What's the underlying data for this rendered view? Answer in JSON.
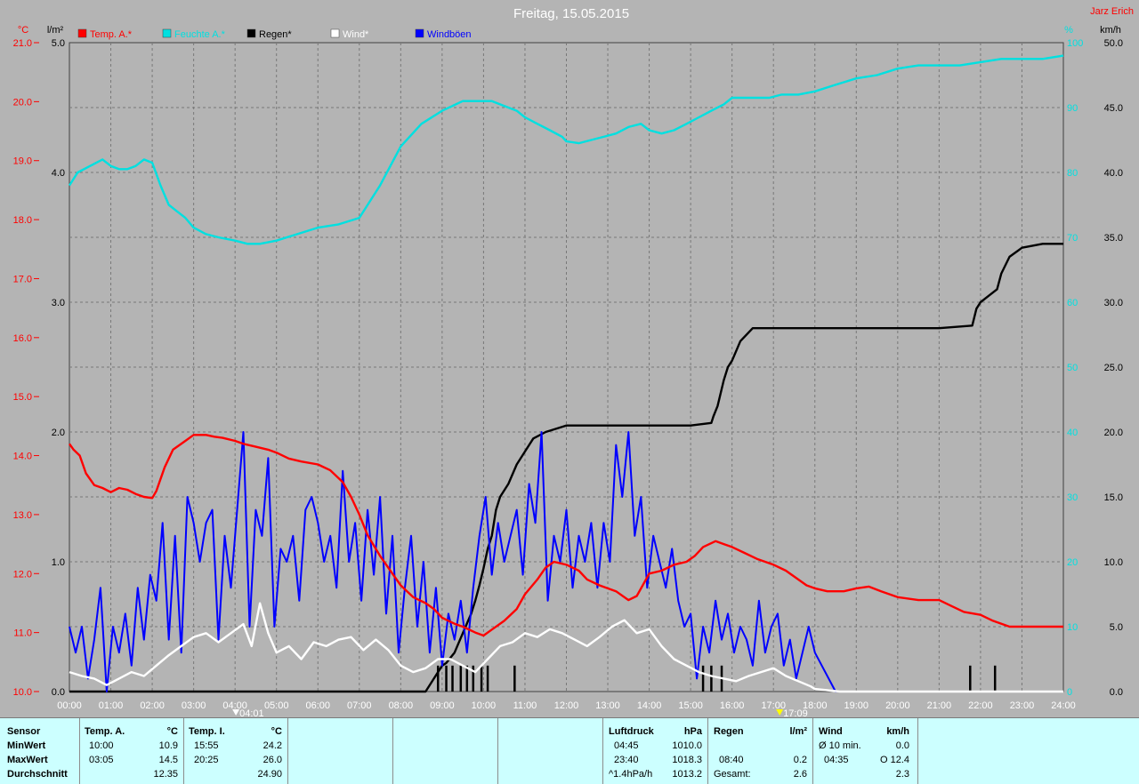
{
  "chart_data": {
    "type": "line",
    "title": "Freitag, 15.05.2015",
    "author": "Jarz Erich",
    "legend": [
      {
        "name": "Temp. A.*",
        "color": "#ff0000"
      },
      {
        "name": "Feuchte A.*",
        "color": "#00e0e0"
      },
      {
        "name": "Regen*",
        "color": "#000000"
      },
      {
        "name": "Wind*",
        "color": "#ffffff"
      },
      {
        "name": "Windböen",
        "color": "#0000ff"
      }
    ],
    "legend_placement": "top-left",
    "grid": true,
    "axes": {
      "temp": {
        "unit": "°C",
        "color": "#ff0000",
        "range": [
          10,
          21
        ],
        "ticks": [
          "10.0",
          "11.0",
          "12.0",
          "13.0",
          "14.0",
          "15.0",
          "16.0",
          "17.0",
          "18.0",
          "19.0",
          "20.0",
          "21.0"
        ]
      },
      "rain": {
        "unit": "l/m²",
        "color": "#000000",
        "range": [
          0,
          5
        ],
        "ticks": [
          "0.0",
          "1.0",
          "2.0",
          "3.0",
          "4.0",
          "5.0"
        ]
      },
      "humidity": {
        "unit": "%",
        "color": "#00e0e0",
        "range": [
          0,
          100
        ],
        "ticks": [
          "0",
          "10",
          "20",
          "30",
          "40",
          "50",
          "60",
          "70",
          "80",
          "90",
          "100"
        ]
      },
      "wind": {
        "unit": "km/h",
        "color": "#000000",
        "range": [
          0,
          50
        ],
        "ticks": [
          "0.0",
          "5.0",
          "10.0",
          "15.0",
          "20.0",
          "25.0",
          "30.0",
          "35.0",
          "40.0",
          "45.0",
          "50.0"
        ]
      }
    },
    "x_range": [
      0,
      24
    ],
    "x_ticks": [
      "00:00",
      "01:00",
      "02:00",
      "03:00",
      "04:00",
      "05:00",
      "06:00",
      "07:00",
      "08:00",
      "09:00",
      "10:00",
      "11:00",
      "12:00",
      "13:00",
      "14:00",
      "15:00",
      "16:00",
      "17:00",
      "18:00",
      "19:00",
      "20:00",
      "21:00",
      "22:00",
      "23:00",
      "24:00"
    ],
    "markers": [
      {
        "label": "04:01",
        "x": 4.02,
        "color": "#ffffff"
      },
      {
        "label": "17:09",
        "x": 17.15,
        "color": "#ffff00"
      }
    ],
    "series": [
      {
        "name": "Temp. A.*",
        "axis": "temp",
        "color": "#ff0000",
        "x": [
          0,
          0.1,
          0.25,
          0.4,
          0.6,
          0.8,
          1.0,
          1.2,
          1.4,
          1.6,
          1.8,
          2.0,
          2.1,
          2.3,
          2.5,
          2.8,
          3.0,
          3.1,
          3.3,
          3.5,
          3.7,
          4.0,
          4.2,
          4.5,
          4.8,
          5.0,
          5.3,
          5.6,
          6.0,
          6.3,
          6.6,
          6.8,
          7.0,
          7.2,
          7.5,
          7.8,
          8.0,
          8.3,
          8.6,
          8.8,
          9.0,
          9.3,
          9.5,
          9.8,
          10.0,
          10.2,
          10.5,
          10.8,
          11.0,
          11.3,
          11.5,
          11.7,
          12.0,
          12.3,
          12.5,
          12.8,
          13.0,
          13.2,
          13.5,
          13.7,
          14.0,
          14.3,
          14.6,
          14.9,
          15.1,
          15.3,
          15.6,
          15.8,
          16.0,
          16.3,
          16.6,
          16.8,
          17.0,
          17.3,
          17.6,
          17.8,
          18.0,
          18.3,
          18.7,
          19.0,
          19.3,
          19.6,
          20.0,
          20.5,
          21.0,
          21.3,
          21.6,
          22.0,
          22.3,
          22.7,
          23.0,
          23.5,
          24.0
        ],
        "y": [
          14.2,
          14.1,
          14.0,
          13.7,
          13.5,
          13.45,
          13.38,
          13.45,
          13.42,
          13.35,
          13.3,
          13.28,
          13.4,
          13.8,
          14.1,
          14.25,
          14.35,
          14.35,
          14.35,
          14.32,
          14.3,
          14.25,
          14.2,
          14.15,
          14.1,
          14.05,
          13.95,
          13.9,
          13.85,
          13.75,
          13.55,
          13.3,
          13.0,
          12.65,
          12.3,
          12.0,
          11.8,
          11.6,
          11.5,
          11.4,
          11.25,
          11.15,
          11.1,
          11.0,
          10.95,
          11.05,
          11.2,
          11.4,
          11.65,
          11.9,
          12.1,
          12.2,
          12.15,
          12.05,
          11.9,
          11.8,
          11.75,
          11.7,
          11.55,
          11.62,
          12.0,
          12.05,
          12.15,
          12.2,
          12.3,
          12.45,
          12.55,
          12.5,
          12.45,
          12.35,
          12.25,
          12.2,
          12.15,
          12.05,
          11.9,
          11.8,
          11.75,
          11.7,
          11.7,
          11.75,
          11.78,
          11.7,
          11.6,
          11.55,
          11.55,
          11.45,
          11.35,
          11.3,
          11.2,
          11.1,
          11.1,
          11.1,
          11.1
        ]
      },
      {
        "name": "Feuchte A.*",
        "axis": "humidity",
        "color": "#00e0e0",
        "x": [
          0,
          0.2,
          0.5,
          0.8,
          1.0,
          1.2,
          1.4,
          1.6,
          1.8,
          2.0,
          2.2,
          2.4,
          2.6,
          2.8,
          3.0,
          3.3,
          3.6,
          4.0,
          4.3,
          4.6,
          5.0,
          5.5,
          6.0,
          6.5,
          7.0,
          7.5,
          8.0,
          8.5,
          9.0,
          9.5,
          10.0,
          10.2,
          10.4,
          10.8,
          11.0,
          11.3,
          11.6,
          11.9,
          12.0,
          12.3,
          12.6,
          12.9,
          13.2,
          13.5,
          13.8,
          14.0,
          14.3,
          14.6,
          14.9,
          15.2,
          15.5,
          15.8,
          16.0,
          16.3,
          16.6,
          16.9,
          17.2,
          17.6,
          18.0,
          18.5,
          19.0,
          19.5,
          20.0,
          20.5,
          21.0,
          21.5,
          22.0,
          22.5,
          23.0,
          23.5,
          24.0
        ],
        "y": [
          78,
          80,
          81,
          82,
          81,
          80.5,
          80.5,
          81,
          82,
          81.5,
          78,
          75,
          74,
          73,
          71.5,
          70.5,
          70,
          69.5,
          69,
          69,
          69.5,
          70.5,
          71.5,
          72,
          73,
          78,
          84,
          87.5,
          89.5,
          91,
          91,
          91,
          90.5,
          89.5,
          88.5,
          87.5,
          86.5,
          85.5,
          84.8,
          84.5,
          85,
          85.5,
          86,
          87,
          87.5,
          86.5,
          86,
          86.5,
          87.5,
          88.5,
          89.5,
          90.5,
          91.5,
          91.5,
          91.5,
          91.5,
          92,
          92,
          92.5,
          93.5,
          94.5,
          95,
          96,
          96.5,
          96.5,
          96.5,
          97,
          97.5,
          97.5,
          97.5,
          98
        ]
      },
      {
        "name": "Regen*",
        "axis": "rain",
        "color": "#000000",
        "x": [
          0,
          8.6,
          8.8,
          9.0,
          9.1,
          9.3,
          9.5,
          9.7,
          9.8,
          9.9,
          10.0,
          10.1,
          10.2,
          10.3,
          10.4,
          10.6,
          10.8,
          11.0,
          11.2,
          11.5,
          12.0,
          13.0,
          14.0,
          15.0,
          15.5,
          15.55,
          15.65,
          15.8,
          15.9,
          16.0,
          16.2,
          16.5,
          17.0,
          18.0,
          19.0,
          20.0,
          21.0,
          21.8,
          21.9,
          22.0,
          22.2,
          22.4,
          22.5,
          22.7,
          23.0,
          23.5,
          24.0
        ],
        "y": [
          0,
          0,
          0.1,
          0.2,
          0.22,
          0.3,
          0.45,
          0.6,
          0.7,
          0.82,
          0.95,
          1.1,
          1.2,
          1.4,
          1.5,
          1.6,
          1.75,
          1.85,
          1.95,
          2.0,
          2.05,
          2.05,
          2.05,
          2.05,
          2.07,
          2.12,
          2.2,
          2.4,
          2.5,
          2.55,
          2.7,
          2.8,
          2.8,
          2.8,
          2.8,
          2.8,
          2.8,
          2.82,
          2.95,
          3.0,
          3.05,
          3.1,
          3.22,
          3.35,
          3.42,
          3.45,
          3.45
        ]
      },
      {
        "name": "Wind*",
        "axis": "wind",
        "color": "#ffffff",
        "x": [
          0,
          0.3,
          0.6,
          0.9,
          1.2,
          1.5,
          1.8,
          2.1,
          2.4,
          2.7,
          3.0,
          3.3,
          3.6,
          3.9,
          4.2,
          4.4,
          4.6,
          4.8,
          5.0,
          5.3,
          5.6,
          5.9,
          6.2,
          6.5,
          6.8,
          7.1,
          7.4,
          7.7,
          8.0,
          8.3,
          8.6,
          8.9,
          9.2,
          9.5,
          9.8,
          10.1,
          10.4,
          10.7,
          11.0,
          11.3,
          11.6,
          11.9,
          12.2,
          12.5,
          12.8,
          13.1,
          13.4,
          13.7,
          14.0,
          14.3,
          14.6,
          14.9,
          15.2,
          15.5,
          15.8,
          16.1,
          16.4,
          16.7,
          17.0,
          17.3,
          17.6,
          17.9,
          18.0,
          18.3,
          18.6,
          19.0,
          20.0,
          21.0,
          22.0,
          23.0,
          24.0
        ],
        "y": [
          1.5,
          1.2,
          1.0,
          0.5,
          1.0,
          1.5,
          1.2,
          2.0,
          2.8,
          3.5,
          4.2,
          4.5,
          3.8,
          4.5,
          5.2,
          3.5,
          6.8,
          4.5,
          3.0,
          3.5,
          2.5,
          3.8,
          3.5,
          4.0,
          4.2,
          3.2,
          4.0,
          3.2,
          2.0,
          1.5,
          1.8,
          2.5,
          2.5,
          2.0,
          1.5,
          2.5,
          3.5,
          3.8,
          4.5,
          4.2,
          4.8,
          4.5,
          4.0,
          3.5,
          4.2,
          5.0,
          5.5,
          4.5,
          4.8,
          3.5,
          2.5,
          2.0,
          1.5,
          1.2,
          1.0,
          0.8,
          1.2,
          1.5,
          1.8,
          1.2,
          0.8,
          0.4,
          0.2,
          0.1,
          0,
          0,
          0,
          0,
          0,
          0,
          0
        ]
      },
      {
        "name": "Windböen",
        "axis": "wind",
        "color": "#0000ff",
        "x": [
          0,
          0.15,
          0.3,
          0.45,
          0.6,
          0.75,
          0.9,
          1.05,
          1.2,
          1.35,
          1.5,
          1.65,
          1.8,
          1.95,
          2.1,
          2.25,
          2.4,
          2.55,
          2.7,
          2.85,
          3.0,
          3.15,
          3.3,
          3.45,
          3.6,
          3.75,
          3.9,
          4.05,
          4.2,
          4.35,
          4.5,
          4.65,
          4.8,
          4.95,
          5.1,
          5.25,
          5.4,
          5.55,
          5.7,
          5.85,
          6.0,
          6.15,
          6.3,
          6.45,
          6.6,
          6.75,
          6.9,
          7.05,
          7.2,
          7.35,
          7.5,
          7.65,
          7.8,
          7.95,
          8.1,
          8.25,
          8.4,
          8.55,
          8.7,
          8.85,
          9.0,
          9.15,
          9.3,
          9.45,
          9.6,
          9.75,
          9.9,
          10.05,
          10.2,
          10.35,
          10.5,
          10.65,
          10.8,
          10.95,
          11.1,
          11.25,
          11.4,
          11.55,
          11.7,
          11.85,
          12.0,
          12.15,
          12.3,
          12.45,
          12.6,
          12.75,
          12.9,
          13.05,
          13.2,
          13.35,
          13.5,
          13.65,
          13.8,
          13.95,
          14.1,
          14.25,
          14.4,
          14.55,
          14.7,
          14.85,
          15.0,
          15.15,
          15.3,
          15.45,
          15.6,
          15.75,
          15.9,
          16.05,
          16.2,
          16.35,
          16.5,
          16.65,
          16.8,
          16.95,
          17.1,
          17.25,
          17.4,
          17.55,
          17.7,
          17.85,
          18.0,
          18.5,
          24.0
        ],
        "y": [
          5,
          3,
          5,
          1,
          4,
          8,
          0,
          5,
          3,
          6,
          2,
          8,
          4,
          9,
          7,
          13,
          4,
          12,
          3,
          15,
          13,
          10,
          13,
          14,
          4,
          12,
          8,
          14,
          20,
          5,
          14,
          12,
          18,
          5,
          11,
          10,
          12,
          7,
          14,
          15,
          13,
          10,
          12,
          8,
          17,
          10,
          13,
          7,
          14,
          9,
          15,
          6,
          12,
          3,
          8,
          12,
          5,
          10,
          3,
          8,
          2,
          6,
          4,
          7,
          3,
          8,
          12,
          15,
          9,
          13,
          10,
          12,
          14,
          9,
          16,
          13,
          20,
          7,
          12,
          10,
          14,
          8,
          12,
          10,
          13,
          8,
          13,
          10,
          19,
          15,
          20,
          12,
          15,
          8,
          12,
          10,
          8,
          11,
          7,
          5,
          6,
          1,
          5,
          3,
          7,
          4,
          6,
          3,
          5,
          4,
          2,
          7,
          3,
          5,
          6,
          2,
          4,
          1,
          3,
          5,
          3,
          0,
          0
        ]
      }
    ],
    "rain_bars": [
      {
        "x": 8.9,
        "y": 0.2
      },
      {
        "x": 9.1,
        "y": 0.2
      },
      {
        "x": 9.25,
        "y": 0.2
      },
      {
        "x": 9.45,
        "y": 0.2
      },
      {
        "x": 9.6,
        "y": 0.2
      },
      {
        "x": 9.75,
        "y": 0.2
      },
      {
        "x": 9.95,
        "y": 0.2
      },
      {
        "x": 10.1,
        "y": 0.2
      },
      {
        "x": 10.75,
        "y": 0.2
      },
      {
        "x": 15.3,
        "y": 0.2
      },
      {
        "x": 15.5,
        "y": 0.2
      },
      {
        "x": 15.75,
        "y": 0.2
      },
      {
        "x": 21.75,
        "y": 0.2
      },
      {
        "x": 22.35,
        "y": 0.2
      }
    ]
  },
  "stats": {
    "sensor": {
      "title": "Sensor",
      "rows": [
        "MinWert",
        "MaxWert",
        "Durchschnitt"
      ]
    },
    "temp_a": {
      "title": "Temp. A.",
      "unit": "°C",
      "rows": [
        [
          "10:00",
          "10.9"
        ],
        [
          "03:05",
          "14.5"
        ],
        [
          "",
          "12.35"
        ]
      ]
    },
    "temp_i": {
      "title": "Temp. I.",
      "unit": "°C",
      "rows": [
        [
          "15:55",
          "24.2"
        ],
        [
          "20:25",
          "26.0"
        ],
        [
          "",
          "24.90"
        ]
      ]
    },
    "pressure": {
      "title": "Luftdruck",
      "unit": "hPa",
      "rows": [
        [
          "04:45",
          "1010.0"
        ],
        [
          "23:40",
          "1018.3"
        ],
        [
          "^1.4hPa/h",
          "1013.2"
        ]
      ]
    },
    "rain": {
      "title": "Regen",
      "unit": "l/m²",
      "rows": [
        [
          "",
          ""
        ],
        [
          "08:40",
          "0.2"
        ],
        [
          "Gesamt:",
          "2.6"
        ]
      ]
    },
    "wind": {
      "title": "Wind",
      "unit": "km/h",
      "rows": [
        [
          "Ø 10 min.",
          "0.0"
        ],
        [
          "04:35",
          "O 12.4"
        ],
        [
          "",
          "2.3"
        ]
      ]
    }
  }
}
